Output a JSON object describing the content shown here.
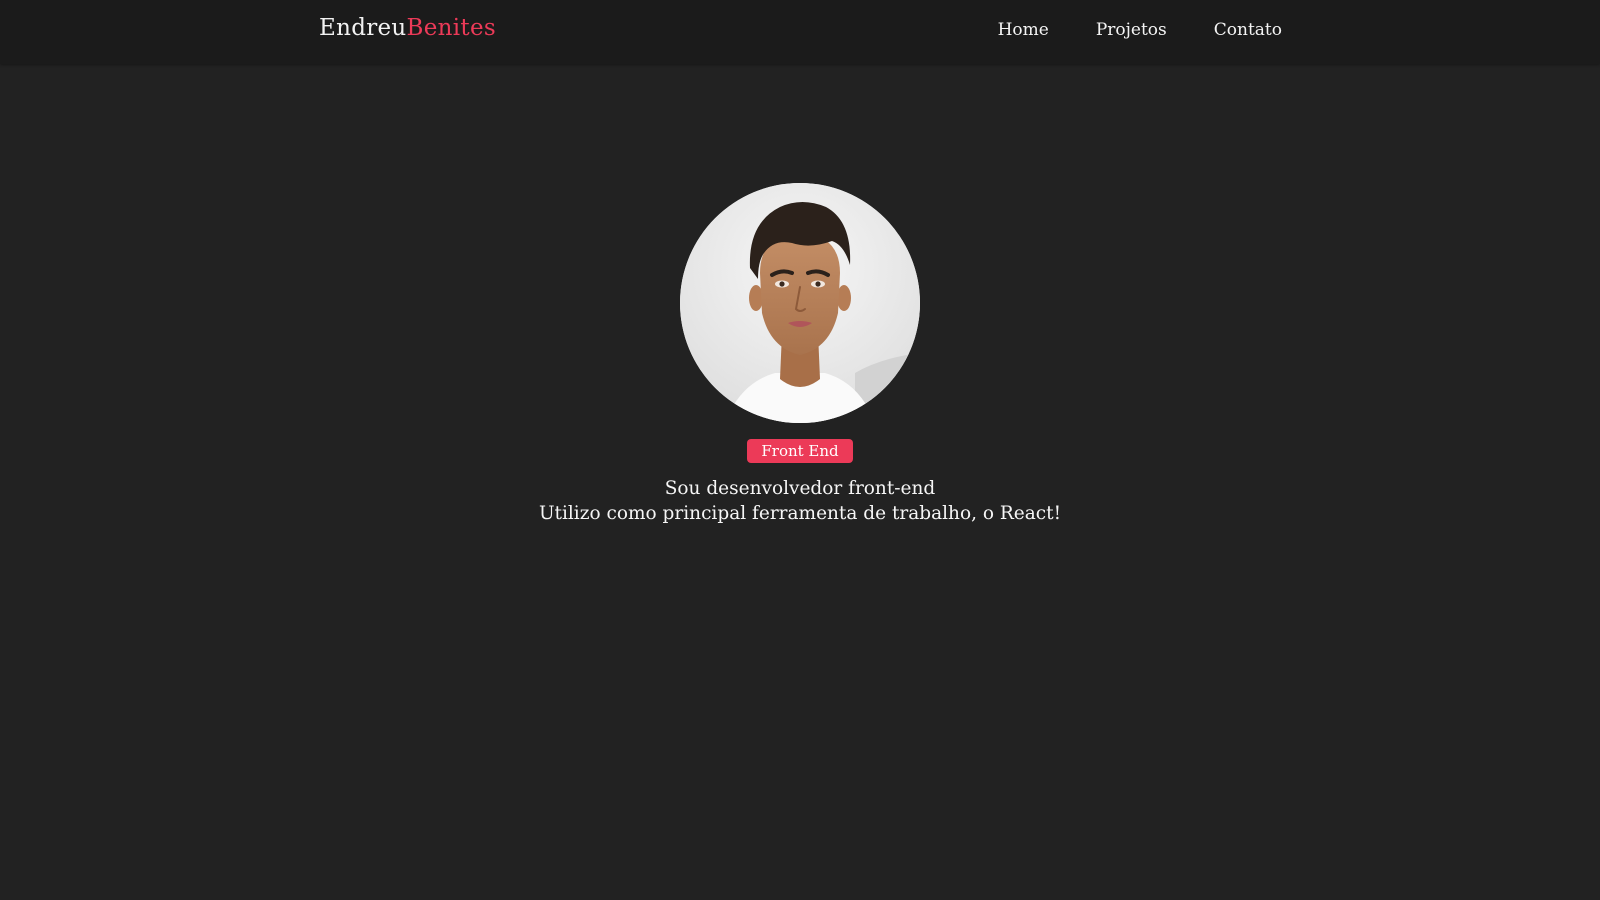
{
  "header": {
    "brand_first": "Endreu",
    "brand_last": "Benites",
    "nav": [
      {
        "label": "Home"
      },
      {
        "label": "Projetos"
      },
      {
        "label": "Contato"
      }
    ]
  },
  "hero": {
    "avatar_icon": "profile-photo",
    "badge": "Front End",
    "bio_line1": "Sou desenvolvedor front-end",
    "bio_line2": "Utilizo como principal ferramenta de trabalho, o React!"
  },
  "colors": {
    "background": "#222222",
    "navbar": "#1b1b1b",
    "accent": "#ec3a58",
    "text": "#ffffff"
  }
}
